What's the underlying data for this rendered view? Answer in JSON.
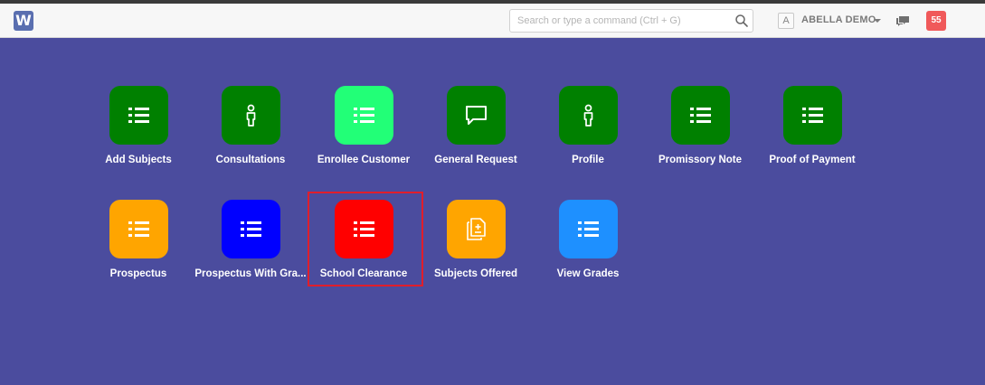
{
  "navbar": {
    "logo_letter": "W",
    "search_placeholder": "Search or type a command (Ctrl + G)",
    "avatar_letter": "A",
    "user_name": "ABELLA DEMO",
    "notification_count": "55"
  },
  "tiles": [
    {
      "label": "Add Subjects",
      "color": "#008000",
      "icon": "list-icon"
    },
    {
      "label": "Consultations",
      "color": "#008000",
      "icon": "person-icon"
    },
    {
      "label": "Enrollee Customer",
      "color": "#22ff77",
      "icon": "list-icon"
    },
    {
      "label": "General Request",
      "color": "#008000",
      "icon": "chat-bubble-icon"
    },
    {
      "label": "Profile",
      "color": "#008000",
      "icon": "person-icon"
    },
    {
      "label": "Promissory Note",
      "color": "#008000",
      "icon": "list-icon"
    },
    {
      "label": "Proof of Payment",
      "color": "#008000",
      "icon": "list-icon"
    },
    {
      "label": "Prospectus",
      "color": "#ffa500",
      "icon": "list-icon"
    },
    {
      "label": "Prospectus With Gra...",
      "color": "#0000ff",
      "icon": "list-icon"
    },
    {
      "label": "School Clearance",
      "color": "#ff0000",
      "icon": "list-icon"
    },
    {
      "label": "Subjects Offered",
      "color": "#ffa500",
      "icon": "document-add-icon"
    },
    {
      "label": "View Grades",
      "color": "#1e90ff",
      "icon": "list-icon"
    }
  ]
}
